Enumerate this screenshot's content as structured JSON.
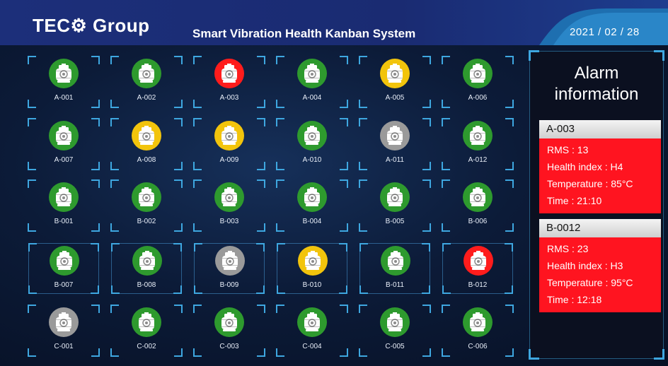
{
  "header": {
    "logo": "TEC⚙ Group",
    "title": "Smart Vibration Health Kanban System",
    "date": "2021 / 02 / 28"
  },
  "colors": {
    "green": "#2e9a2e",
    "yellow": "#f2c40c",
    "red": "#ff1c1c",
    "gray": "#9a9a9a"
  },
  "motors": [
    {
      "id": "A-001",
      "status": "green"
    },
    {
      "id": "A-002",
      "status": "green"
    },
    {
      "id": "A-003",
      "status": "red"
    },
    {
      "id": "A-004",
      "status": "green"
    },
    {
      "id": "A-005",
      "status": "yellow"
    },
    {
      "id": "A-006",
      "status": "green"
    },
    {
      "id": "A-007",
      "status": "green"
    },
    {
      "id": "A-008",
      "status": "yellow"
    },
    {
      "id": "A-009",
      "status": "yellow"
    },
    {
      "id": "A-010",
      "status": "green"
    },
    {
      "id": "A-011",
      "status": "gray"
    },
    {
      "id": "A-012",
      "status": "green"
    },
    {
      "id": "B-001",
      "status": "green"
    },
    {
      "id": "B-002",
      "status": "green"
    },
    {
      "id": "B-003",
      "status": "green"
    },
    {
      "id": "B-004",
      "status": "green"
    },
    {
      "id": "B-005",
      "status": "green"
    },
    {
      "id": "B-006",
      "status": "green"
    },
    {
      "id": "B-007",
      "status": "green",
      "framed": true
    },
    {
      "id": "B-008",
      "status": "green",
      "framed": true
    },
    {
      "id": "B-009",
      "status": "gray",
      "framed": true
    },
    {
      "id": "B-010",
      "status": "yellow",
      "framed": true
    },
    {
      "id": "B-011",
      "status": "green",
      "framed": true
    },
    {
      "id": "B-012",
      "status": "red",
      "framed": true
    },
    {
      "id": "C-001",
      "status": "gray"
    },
    {
      "id": "C-002",
      "status": "green"
    },
    {
      "id": "C-003",
      "status": "green"
    },
    {
      "id": "C-004",
      "status": "green"
    },
    {
      "id": "C-005",
      "status": "green"
    },
    {
      "id": "C-006",
      "status": "green"
    }
  ],
  "panel": {
    "title": "Alarm information"
  },
  "alarms": [
    {
      "id": "A-003",
      "rms": "RMS : 13",
      "health": "Health index : H4",
      "temperature": "Temperature : 85°C",
      "time": "Time : 21:10"
    },
    {
      "id": "B-0012",
      "rms": "RMS : 23",
      "health": "Health index : H3",
      "temperature": "Temperature : 95°C",
      "time": "Time : 12:18"
    }
  ]
}
